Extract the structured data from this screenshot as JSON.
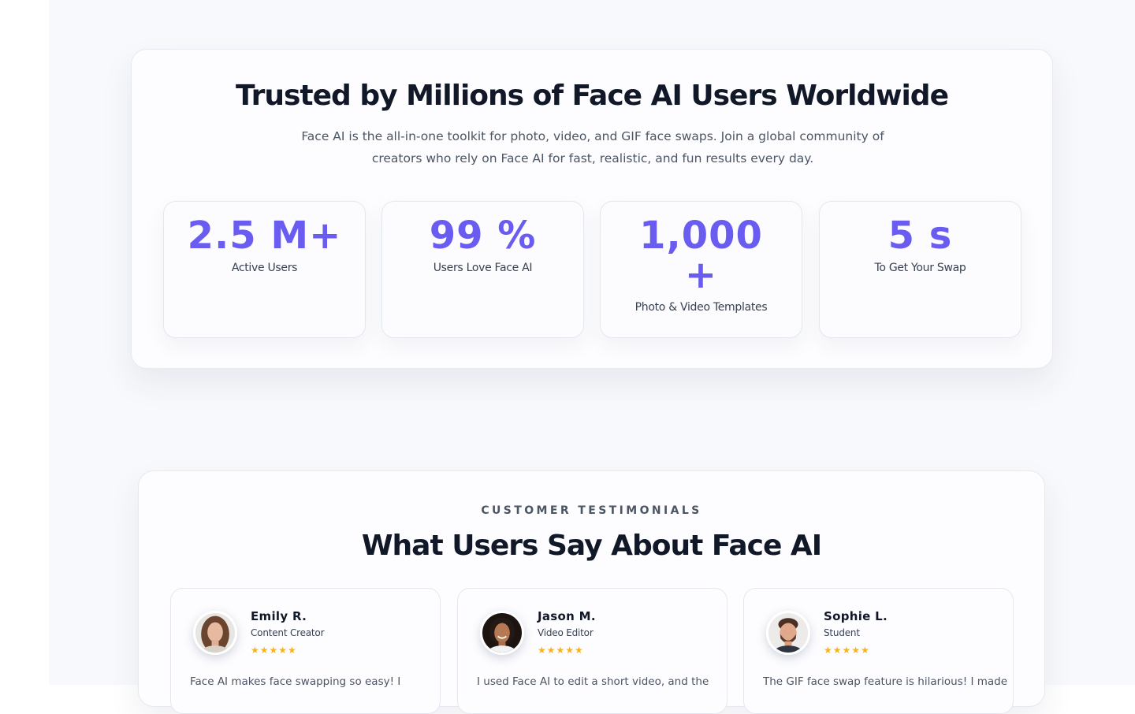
{
  "stats": {
    "title": "Trusted by Millions of Face AI Users Worldwide",
    "subtitle": "Face AI is the all-in-one toolkit for photo, video, and GIF face swaps. Join a global community of creators who rely on Face AI for fast, realistic, and fun results every day.",
    "items": [
      {
        "value": "2.5 M+",
        "label": "Active Users"
      },
      {
        "value": "99 %",
        "label": "Users Love Face AI"
      },
      {
        "value": "1,000 +",
        "label": "Photo & Video Templates"
      },
      {
        "value": "5 s",
        "label": "To Get Your Swap"
      }
    ],
    "accent_color": "#6a5cf0"
  },
  "testimonials": {
    "eyebrow": "CUSTOMER TESTIMONIALS",
    "title": "What Users Say About Face AI",
    "star_color": "#f5b323",
    "reviews": [
      {
        "name": "Emily R.",
        "role": "Content Creator",
        "stars": "★★★★★",
        "text": "Face AI makes face swapping so easy! I",
        "avatar_icon": "woman-portrait"
      },
      {
        "name": "Jason M.",
        "role": "Video Editor",
        "stars": "★★★★★",
        "text": "I used Face AI to edit a short video, and the",
        "avatar_icon": "woman-portrait"
      },
      {
        "name": "Sophie L.",
        "role": "Student",
        "stars": "★★★★★",
        "text": "The GIF face swap feature is hilarious! I made",
        "avatar_icon": "man-portrait"
      }
    ]
  }
}
